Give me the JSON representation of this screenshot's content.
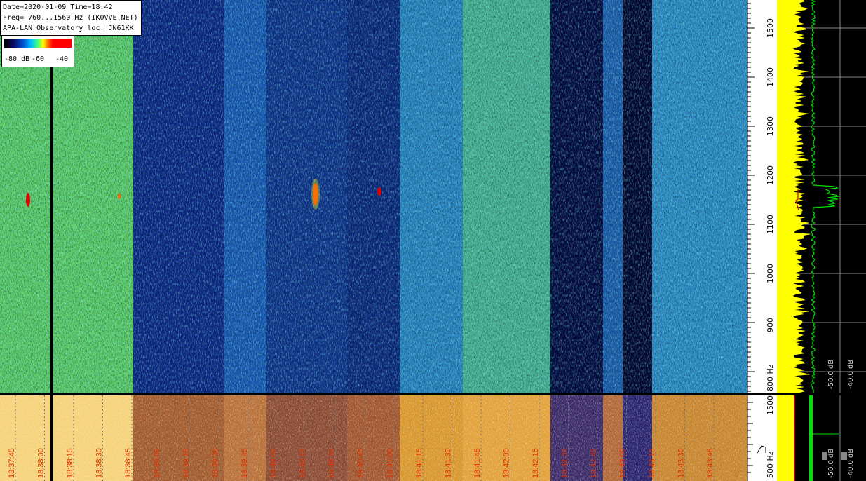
{
  "info": {
    "line1": "Date=2020-01-09 Time=18:42",
    "line2": "Freq= 760...1560 Hz (IK0VVE.NET)",
    "line3": "APA-LAN Observatory loc: JN61KK"
  },
  "legend": {
    "labels": [
      "-80 dB",
      "-60",
      "-40"
    ]
  },
  "freq_axis": {
    "ticks": [
      "1500",
      "1400",
      "1300",
      "1200",
      "1100",
      "1000",
      "900",
      "800 Hz"
    ]
  },
  "freq_axis_bottom": {
    "ticks": [
      "1500",
      "500 Hz"
    ]
  },
  "spectrum_labels": {
    "top": [
      "-50.0 dB",
      "-40.0 dB"
    ],
    "bottom": [
      "-50.0 dB",
      "-40.0 dB"
    ]
  },
  "time_labels": [
    "18:37:45",
    "18:38:00",
    "18:38:15",
    "18:38:30",
    "18:38:45",
    "18:39:00",
    "18:39:15",
    "18:39:30",
    "18:39:45",
    "18:40:00",
    "18:40:15",
    "18:40:30",
    "18:40:45",
    "18:41:00",
    "18:41:15",
    "18:41:30",
    "18:41:45",
    "18:42:00",
    "18:42:15",
    "18:42:30",
    "18:42:45",
    "18:43:00",
    "18:43:15",
    "18:43:30",
    "18:43:45"
  ],
  "colors": {
    "axis_bg": "#ffffff",
    "time_label": "#e03000",
    "trace_yellow": "#ffff00",
    "trace_green": "#00ff00"
  }
}
